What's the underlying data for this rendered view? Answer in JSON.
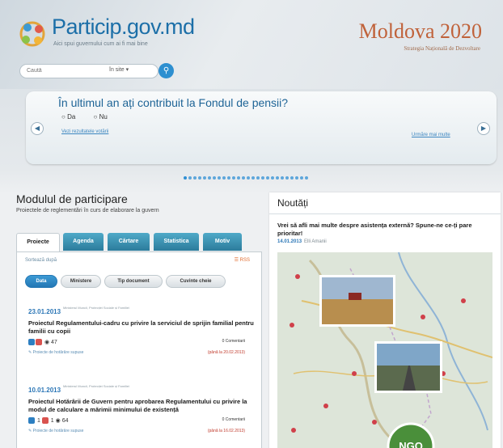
{
  "header": {
    "brand": "Particip.gov.md",
    "tagline": "Aici spui guvernului cum ai fi mai bine",
    "moldova": "Moldova 2020",
    "moldova_sub": "Strategia Națională de Dezvoltare"
  },
  "search": {
    "placeholder": "Caută",
    "scope": "în site",
    "icon": "search-icon"
  },
  "poll": {
    "question": "În ultimul an ați contribuit la Fondul de pensii?",
    "options": [
      "Da",
      "Nu"
    ],
    "results_link": "Vezi rezultatele votării",
    "more_link": "Urmăre mai multe"
  },
  "slider": {
    "dots": 26,
    "active": 0
  },
  "participation": {
    "title": "Modulul de participare",
    "subtitle": "Proiectele de reglementări în curs de elaborare la guvern",
    "tabs": [
      "Proiecte",
      "Agenda",
      "Cărtare",
      "Statistica",
      "Motiv"
    ],
    "panel_head": "Sortează după",
    "rss": "RSS",
    "filters": [
      "Data",
      "Ministere",
      "Tip document",
      "Cuvinte cheie"
    ],
    "items": [
      {
        "date": "23.01.2013",
        "department": "Ministerul Muncii, Protecției Sociale și Familiei",
        "title": "Proiectul Regulamentului-cadru cu privire la serviciul de sprijin familial pentru familii cu copii",
        "views": "47",
        "comments": "0 Comentarii",
        "link": "Proiecte de hotărâre supuse",
        "deadline": "(până la 20.02.2013)"
      },
      {
        "date": "10.01.2013",
        "department": "Ministerul Muncii, Protecției Sociale și Familiei",
        "title": "Proiectul Hotărârii de Guvern pentru aprobarea Regulamentului cu privire la modul de calculare a mărimii minimului de existență",
        "views": "64",
        "comments": "0 Comentarii",
        "link": "Proiecte de hotărâre supuse",
        "deadline": "(până la 16.02.2013)",
        "counts": [
          "1",
          "1"
        ]
      }
    ]
  },
  "news": {
    "title": "Noutăți",
    "headline": "Vrei să afli mai multe despre asistența externă? Spune-ne ce-ți pare prioritar!",
    "date": "14.01.2013",
    "author": "Elli Amanii"
  },
  "colors": {
    "brand": "#1c6fa8",
    "accent": "#2d8fd0",
    "moldova": "#c0623a",
    "tab": "#2c7c9c",
    "date": "#2b76b6"
  }
}
